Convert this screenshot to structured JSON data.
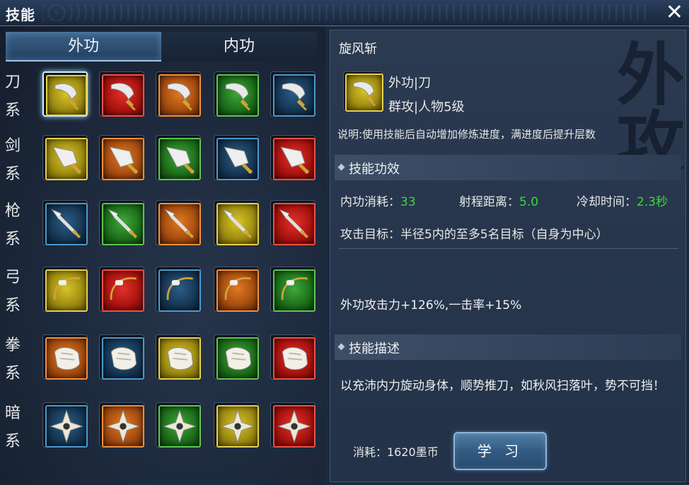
{
  "window": {
    "title": "技能",
    "close_icon": "close-icon"
  },
  "tabs": [
    {
      "label": "外功",
      "active": true
    },
    {
      "label": "内功",
      "active": false
    }
  ],
  "categories": [
    {
      "label": [
        "刀",
        "系"
      ],
      "weapon": "blade",
      "colors": [
        "yellow",
        "red",
        "orange",
        "green",
        "blue"
      ],
      "selected_index": 0
    },
    {
      "label": [
        "剑",
        "系"
      ],
      "weapon": "sword",
      "colors": [
        "yellow",
        "orange",
        "green",
        "blue",
        "red"
      ]
    },
    {
      "label": [
        "枪",
        "系"
      ],
      "weapon": "spear",
      "colors": [
        "blue",
        "green",
        "orange",
        "yellow",
        "red"
      ]
    },
    {
      "label": [
        "弓",
        "系"
      ],
      "weapon": "bow",
      "colors": [
        "yellow",
        "red",
        "blue",
        "orange",
        "green"
      ]
    },
    {
      "label": [
        "拳",
        "系"
      ],
      "weapon": "fist",
      "colors": [
        "orange",
        "blue",
        "yellow",
        "green",
        "red"
      ]
    },
    {
      "label": [
        "暗",
        "系"
      ],
      "weapon": "shuriken",
      "colors": [
        "blue",
        "orange",
        "green",
        "yellow",
        "red"
      ]
    }
  ],
  "detail": {
    "name": "旋风斩",
    "type_line": "外功|刀",
    "target_line": "群攻|人物5级",
    "description": "说明:使用技能后自动增加修炼进度，满进度后提升层数",
    "effects_header": "技能功效",
    "stats": {
      "mp_label": "内功消耗：",
      "mp_value": "33",
      "range_label": "射程距离：",
      "range_value": "5.0",
      "cd_label": "冷却时间：",
      "cd_value": "2.3秒"
    },
    "target_text": "攻击目标：半径5内的至多5名目标（自身为中心）",
    "effect_text": "外功攻击力+126%,一击率+15%",
    "desc_header": "技能描述",
    "story": "以充沛内力旋动身体，顺势推刀，如秋风扫落叶，势不可挡！",
    "cost": "消耗：1620墨币",
    "learn_label": "学 习",
    "watermark": "外攻"
  },
  "colors": {
    "value_green": "#41d43f",
    "tab_active": "#2c4e72"
  }
}
